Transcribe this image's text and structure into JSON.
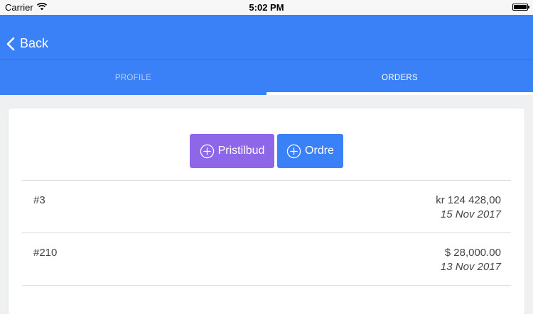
{
  "status_bar": {
    "carrier": "Carrier",
    "time": "5:02 PM",
    "icons": [
      "wifi-icon",
      "battery-icon"
    ]
  },
  "nav": {
    "back_label": "Back",
    "back_icon": "chevron-left-icon"
  },
  "tabs": [
    {
      "label": "PROFILE",
      "active": false
    },
    {
      "label": "ORDERS",
      "active": true
    }
  ],
  "actions": {
    "quote_label": "Pristilbud",
    "order_label": "Ordre",
    "icon": "plus-circle-icon"
  },
  "orders": [
    {
      "number": "#3",
      "amount": "kr 124 428,00",
      "date": "15 Nov 2017"
    },
    {
      "number": "#210",
      "amount": "$ 28,000.00",
      "date": "13 Nov 2017"
    }
  ],
  "colors": {
    "primary": "#3a80f6",
    "quote_button": "#8e67e8",
    "background": "#eef0f1"
  }
}
